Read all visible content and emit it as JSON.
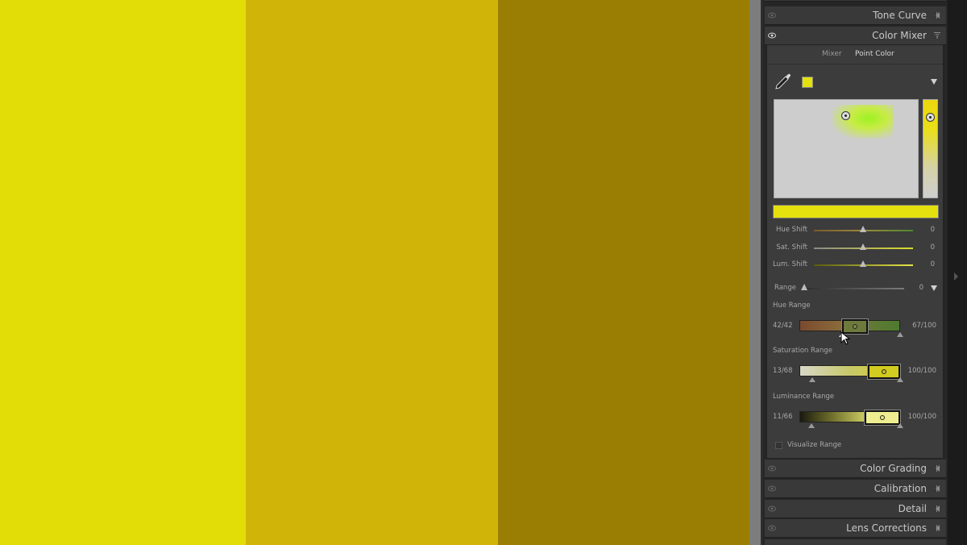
{
  "canvas": {
    "swatches": [
      "#e2dd07",
      "#d1b408",
      "#9a7e03"
    ]
  },
  "panels": {
    "tone_curve": "Tone Curve",
    "color_mixer": "Color Mixer",
    "color_grading": "Color Grading",
    "calibration": "Calibration",
    "detail": "Detail",
    "lens_corrections": "Lens Corrections"
  },
  "mixer": {
    "tab_mixer": "Mixer",
    "tab_point_color": "Point Color",
    "sample_color": "#e4e10f",
    "hue_shift": {
      "label": "Hue Shift",
      "value": "0"
    },
    "sat_shift": {
      "label": "Sat. Shift",
      "value": "0"
    },
    "lum_shift": {
      "label": "Lum. Shift",
      "value": "0"
    },
    "range": {
      "label": "Range",
      "value": "0"
    },
    "hue_range": {
      "label": "Hue Range",
      "left": "42/42",
      "right": "67/100"
    },
    "saturation_range": {
      "label": "Saturation Range",
      "left": "13/68",
      "right": "100/100"
    },
    "luminance_range": {
      "label": "Luminance Range",
      "left": "11/66",
      "right": "100/100"
    },
    "visualize_range": "Visualize Range"
  },
  "icons": [
    "eye-icon",
    "collapse-arrow-icon",
    "filter-icon",
    "eyedropper-icon",
    "dropdown-arrow-icon",
    "cursor-icon"
  ]
}
